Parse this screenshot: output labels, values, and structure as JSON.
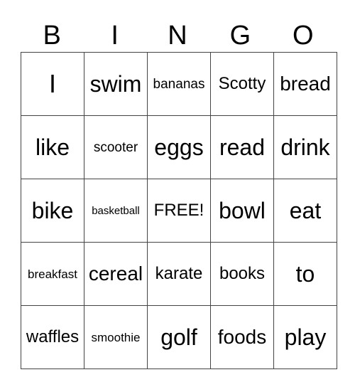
{
  "header": [
    "B",
    "I",
    "N",
    "G",
    "O"
  ],
  "rows": [
    [
      "I",
      "swim",
      "bananas",
      "Scotty",
      "bread"
    ],
    [
      "like",
      "scooter",
      "eggs",
      "read",
      "drink"
    ],
    [
      "bike",
      "basketball",
      "FREE!",
      "bowl",
      "eat"
    ],
    [
      "breakfast",
      "cereal",
      "karate",
      "books",
      "to"
    ],
    [
      "waffles",
      "smoothie",
      "golf",
      "foods",
      "play"
    ]
  ]
}
